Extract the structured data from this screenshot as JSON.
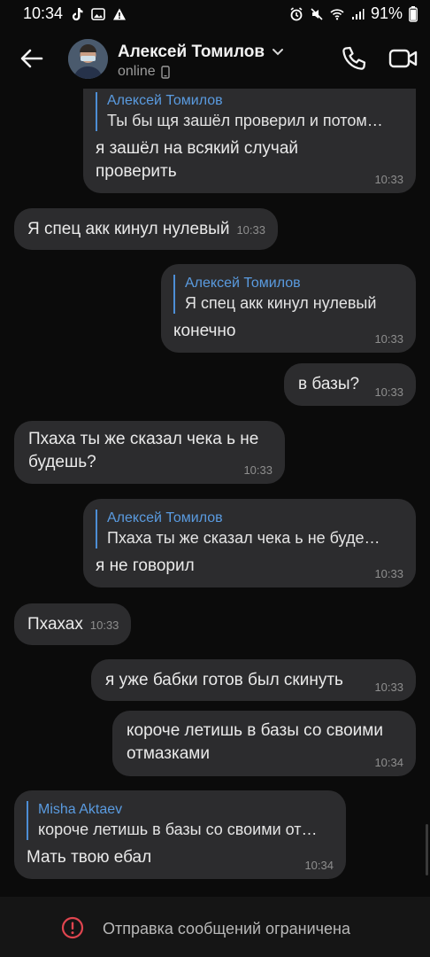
{
  "status_bar": {
    "time": "10:34",
    "battery": "91%"
  },
  "header": {
    "name": "Алексей Томилов",
    "status": "online"
  },
  "messages": [
    {
      "reply_name": "Алексей Томилов",
      "reply_text": "Ты бы щя зашёл проверил и потом…",
      "text_line1": "я зашёл на всякий случай",
      "text_line2": "проверить",
      "time": "10:33"
    },
    {
      "text": "Я спец акк кинул нулевый",
      "time": "10:33"
    },
    {
      "reply_name": "Алексей Томилов",
      "reply_text": "Я спец акк кинул нулевый",
      "text": "конечно",
      "time": "10:33"
    },
    {
      "text": "в базы?",
      "time": "10:33"
    },
    {
      "text_line1": "Пхаха ты же сказал чека ь не",
      "text_line2": "будешь?",
      "time": "10:33"
    },
    {
      "reply_name": "Алексей Томилов",
      "reply_text": "Пхаха ты же сказал чека ь не буде…",
      "text": "я не говорил",
      "time": "10:33"
    },
    {
      "text": "Пхахах",
      "time": "10:33"
    },
    {
      "text": "я уже бабки готов был скинуть",
      "time": "10:33"
    },
    {
      "text_line1": "короче летишь в базы со своими",
      "text_line2": "отмазками",
      "time": "10:34"
    },
    {
      "reply_name": "Misha Aktaev",
      "reply_text": "короче летишь в базы со своими от…",
      "text": "Мать твою ебал",
      "time": "10:34"
    }
  ],
  "bottom": {
    "restricted_text": "Отправка сообщений ограничена"
  }
}
